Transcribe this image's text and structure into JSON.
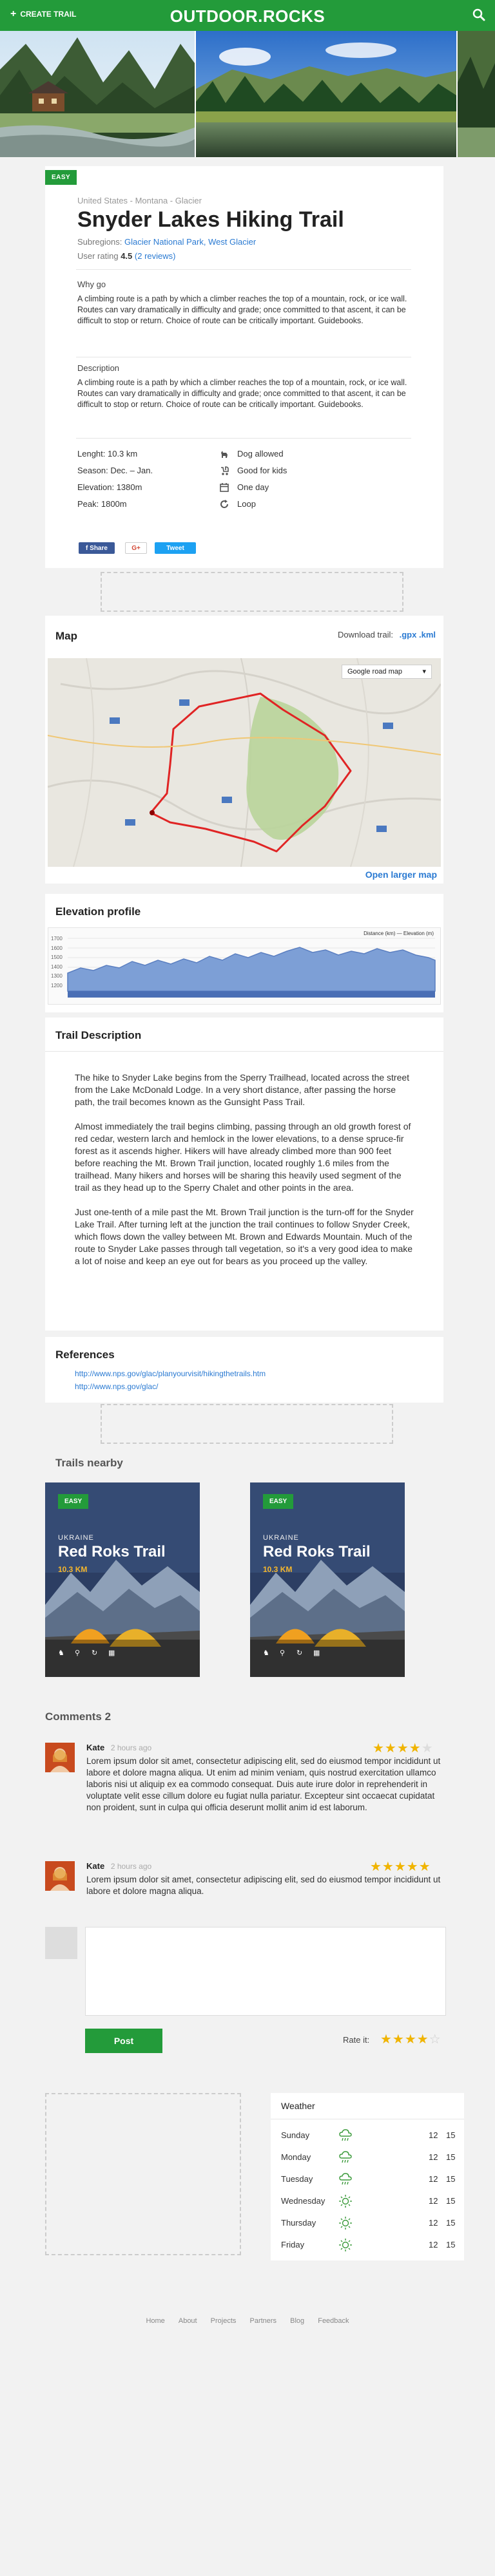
{
  "header": {
    "create_label": "CREATE TRAIL",
    "logo": "OUTDOOR.ROCKS",
    "search_icon": "search-icon",
    "brand_color": "#239b3a"
  },
  "trail": {
    "difficulty": "EASY",
    "breadcrumb": "United States - Montana - Glacier",
    "title": "Snyder Lakes Hiking Trail",
    "subregions_label": "Subregions:",
    "subregions": "Glacier National Park, West Glacier",
    "rating_label": "User rating",
    "rating_value": "4.5",
    "rating_reviews": "(2 reviews)",
    "why_go_label": "Why go",
    "why_go_text": "A climbing route is a path by which a climber reaches the top of a mountain, rock, or ice wall. Routes can vary dramatically in difficulty and grade; once committed to that ascent, it can be difficult to stop or return. Choice of route can be critically important. Guidebooks.",
    "description_label": "Description",
    "description_text": "A climbing route is a path by which a climber reaches the top of a mountain, rock, or ice wall. Routes can vary dramatically in difficulty and grade; once committed to that ascent, it can be difficult to stop or return. Choice of route can be critically important. Guidebooks.",
    "stats": {
      "length": "Lenght: 10.3 km",
      "season": "Season: Dec. – Jan.",
      "elevation": "Elevation: 1380m",
      "peak": "Peak: 1800m"
    },
    "features": [
      {
        "icon": "dog-icon",
        "label": "Dog allowed"
      },
      {
        "icon": "stroller-icon",
        "label": "Good for kids"
      },
      {
        "icon": "calendar-icon",
        "label": "One day"
      },
      {
        "icon": "loop-icon",
        "label": "Loop"
      }
    ],
    "share": {
      "facebook": "f Share",
      "google": "G+",
      "twitter": "Tweet"
    }
  },
  "map": {
    "title": "Map",
    "download_label": "Download trail:",
    "gpx": ".gpx",
    "kml": ".kml",
    "map_type": "Google road map",
    "open_larger": "Open larger map"
  },
  "elevation": {
    "title": "Elevation profile",
    "legend": "Distance (km) — Elevation (m)",
    "yticks": [
      "1700",
      "1600",
      "1500",
      "1400",
      "1300",
      "1200"
    ]
  },
  "description": {
    "title": "Trail Description",
    "paragraphs": [
      "The hike to Snyder Lake begins from the Sperry Trailhead, located across the street from the Lake McDonald Lodge. In a very short distance, after passing the horse path, the trail becomes known as the Gunsight Pass Trail.",
      "Almost immediately the trail begins climbing, passing through an old growth forest of red cedar, western larch and hemlock in the lower elevations, to a dense spruce-fir forest as it ascends higher. Hikers will have already climbed more than 900 feet before reaching the Mt. Brown Trail junction, located roughly 1.6 miles from the trailhead. Many hikers and horses will be sharing this heavily used segment of the trail as they head up to the Sperry Chalet and other points in the area.",
      "Just one-tenth of a mile past the Mt. Brown Trail junction is the turn-off for the Snyder Lake Trail. After turning left at the junction the trail continues to follow Snyder Creek, which flows down the valley between Mt. Brown and Edwards Mountain. Much of the route to Snyder Lake passes through tall vegetation, so it's a very good idea to make a lot of noise and keep an eye out for bears as you proceed up the valley."
    ]
  },
  "references": {
    "title": "References",
    "links": [
      "http://www.nps.gov/glac/planyourvisit/hikingthetrails.htm",
      "http://www.nps.gov/glac/"
    ]
  },
  "nearby": {
    "title": "Trails nearby",
    "cards": [
      {
        "badge": "EASY",
        "region": "UKRAINE",
        "name": "Red Roks Trail",
        "distance": "10.3 KM"
      },
      {
        "badge": "EASY",
        "region": "UKRAINE",
        "name": "Red Roks Trail",
        "distance": "10.3 KM"
      }
    ]
  },
  "comments": {
    "title": "Comments 2",
    "items": [
      {
        "name": "Kate",
        "time": "2 hours ago",
        "stars": 4,
        "text": "Lorem ipsum dolor sit amet, consectetur adipiscing elit, sed do eiusmod tempor incididunt ut labore et dolore magna aliqua. Ut enim ad minim veniam, quis nostrud exercitation ullamco laboris nisi ut aliquip ex ea commodo consequat. Duis aute irure dolor in reprehenderit in voluptate velit esse cillum dolore eu fugiat nulla pariatur. Excepteur sint occaecat cupidatat non proident, sunt in culpa qui officia deserunt mollit anim id est laborum."
      },
      {
        "name": "Kate",
        "time": "2 hours ago",
        "stars": 5,
        "text": "Lorem ipsum dolor sit amet, consectetur adipiscing elit, sed do eiusmod tempor incididunt ut labore et dolore magna aliqua."
      }
    ],
    "post_label": "Post",
    "rate_label": "Rate it:",
    "rate_value": 4
  },
  "weather": {
    "title": "Weather",
    "days": [
      {
        "day": "Sunday",
        "icon": "rain-icon",
        "t1": "12",
        "t2": "15"
      },
      {
        "day": "Monday",
        "icon": "rain-icon",
        "t1": "12",
        "t2": "15"
      },
      {
        "day": "Tuesday",
        "icon": "rain-icon",
        "t1": "12",
        "t2": "15"
      },
      {
        "day": "Wednesday",
        "icon": "sun-icon",
        "t1": "12",
        "t2": "15"
      },
      {
        "day": "Thursday",
        "icon": "sun-icon",
        "t1": "12",
        "t2": "15"
      },
      {
        "day": "Friday",
        "icon": "sun-icon",
        "t1": "12",
        "t2": "15"
      }
    ]
  },
  "footer": {
    "links": [
      "Home",
      "About",
      "Projects",
      "Partners",
      "Blog",
      "Feedback"
    ]
  }
}
